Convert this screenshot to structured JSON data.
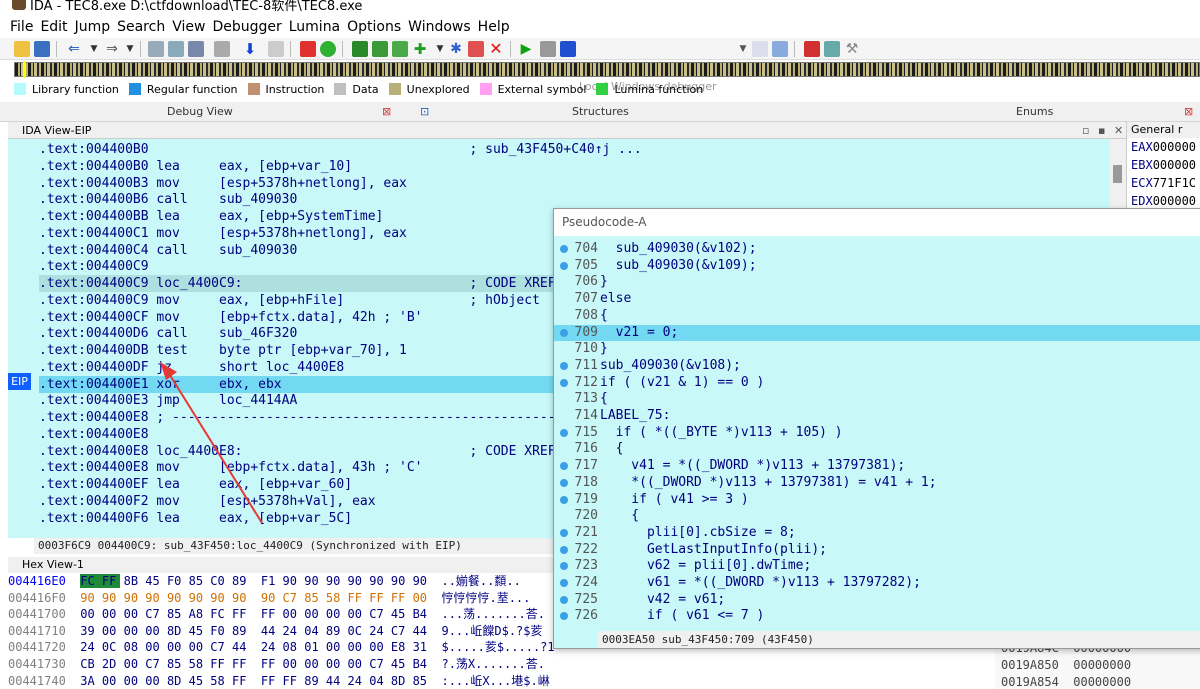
{
  "title": "IDA - TEC8.exe D:\\ctfdownload\\TEC-8软件\\TEC8.exe",
  "menu": [
    "File",
    "Edit",
    "Jump",
    "Search",
    "View",
    "Debugger",
    "Lumina",
    "Options",
    "Windows",
    "Help"
  ],
  "debugger_select": "Local Windows debugger",
  "legend": [
    {
      "label": "Library function",
      "color": "#b4fcfc"
    },
    {
      "label": "Regular function",
      "color": "#2090e0"
    },
    {
      "label": "Instruction",
      "color": "#c09070"
    },
    {
      "label": "Data",
      "color": "#c0c0c0"
    },
    {
      "label": "Unexplored",
      "color": "#b8b078"
    },
    {
      "label": "External symbol",
      "color": "#ffa0f0"
    },
    {
      "label": "Lumina function",
      "color": "#30d040"
    }
  ],
  "tabs": {
    "debug_view": "Debug View",
    "structures": "Structures",
    "enums": "Enums"
  },
  "ida_view": {
    "header": "IDA View-EIP",
    "lines": [
      ".text:004400B0                                         ; sub_43F450+C40↑j ...",
      ".text:004400B0 lea     eax, [ebp+var_10]",
      ".text:004400B3 mov     [esp+5378h+netlong], eax",
      ".text:004400B6 call    sub_409030",
      ".text:004400BB lea     eax, [ebp+SystemTime]",
      ".text:004400C1 mov     [esp+5378h+netlong], eax",
      ".text:004400C4 call    sub_409030",
      ".text:004400C9",
      ".text:004400C9 loc_4400C9:                             ; CODE XREF",
      ".text:004400C9 mov     eax, [ebp+hFile]                ; hObject",
      ".text:004400CF mov     [ebp+fctx.data], 42h ; 'B'",
      ".text:004400D6 call    sub_46F320",
      ".text:004400DB test    byte ptr [ebp+var_70], 1",
      ".text:004400DF jz      short loc_4400E8",
      ".text:004400E1 xor     ebx, ebx",
      ".text:004400E3 jmp     loc_4414AA",
      ".text:004400E8 ; ---------------------------------------------------------",
      ".text:004400E8",
      ".text:004400E8 loc_4400E8:                             ; CODE XREF",
      ".text:004400E8 mov     [ebp+fctx.data], 43h ; 'C'",
      ".text:004400EF lea     eax, [ebp+var_60]",
      ".text:004400F2 mov     [esp+5378h+Val], eax",
      ".text:004400F6 lea     eax, [ebp+var_5C]"
    ],
    "eip_label": "EIP",
    "status": "0003F6C9 004400C9: sub_43F450:loc_4400C9 (Synchronized with EIP)"
  },
  "registers": {
    "header": "General r",
    "rows": [
      {
        "name": "EAX",
        "val": "000000"
      },
      {
        "name": "EBX",
        "val": "000000"
      },
      {
        "name": "ECX",
        "val": "771F1C"
      },
      {
        "name": "EDX",
        "val": "000000"
      }
    ]
  },
  "hex_view": {
    "header": "Hex View-1",
    "rows": [
      {
        "addr": "004416E0",
        "bytes": "FC FF 8B 45 F0 85 C0 89  F1 90 90 90 90 90 90 90",
        "ascii": "..媊餐..纇.."
      },
      {
        "addr": "004416F0",
        "bytes": "90 90 90 90 90 90 90 90  90 C7 85 58 FF FF FF 00",
        "ascii": "悙悙悙悙.荎..."
      },
      {
        "addr": "00441700",
        "bytes": "00 00 00 C7 85 A8 FC FF  FF 00 00 00 00 C7 45 B4",
        "ascii": "...荡.......荅."
      },
      {
        "addr": "00441710",
        "bytes": "39 00 00 00 8D 45 F0 89  44 24 04 89 0C 24 C7 44",
        "ascii": "9...岴饓D$.?$荄"
      },
      {
        "addr": "00441720",
        "bytes": "24 0C 08 00 00 00 C7 44  24 08 01 00 00 00 E8 31",
        "ascii": "$.....荄$.....?1"
      },
      {
        "addr": "00441730",
        "bytes": "CB 2D 00 C7 85 58 FF FF  FF 00 00 00 00 C7 45 B4",
        "ascii": "?.荡X.......荅."
      },
      {
        "addr": "00441740",
        "bytes": "3A 00 00 00 8D 45 58 FF  FF FF 89 44 24 04 8D 85",
        "ascii": ":...岴X...塂$.崊"
      }
    ]
  },
  "stack": {
    "rows": [
      {
        "addr": "0019A84C",
        "val": "00000000"
      },
      {
        "addr": "0019A850",
        "val": "00000000"
      },
      {
        "addr": "0019A854",
        "val": "00000000"
      }
    ]
  },
  "pseudocode": {
    "header": "Pseudocode-A",
    "lines": [
      {
        "n": "704",
        "dot": true,
        "code": "  sub_409030(&v102);"
      },
      {
        "n": "705",
        "dot": true,
        "code": "  sub_409030(&v109);"
      },
      {
        "n": "706",
        "dot": false,
        "code": "}"
      },
      {
        "n": "707",
        "dot": false,
        "code": "else"
      },
      {
        "n": "708",
        "dot": false,
        "code": "{"
      },
      {
        "n": "709",
        "dot": true,
        "code": "  v21 = 0;"
      },
      {
        "n": "710",
        "dot": false,
        "code": "}"
      },
      {
        "n": "711",
        "dot": true,
        "code": "sub_409030(&v108);"
      },
      {
        "n": "712",
        "dot": true,
        "code": "if ( (v21 & 1) == 0 )"
      },
      {
        "n": "713",
        "dot": false,
        "code": "{"
      },
      {
        "n": "714",
        "dot": false,
        "code": "LABEL_75:"
      },
      {
        "n": "715",
        "dot": true,
        "code": "  if ( *((_BYTE *)v113 + 105) )"
      },
      {
        "n": "716",
        "dot": false,
        "code": "  {"
      },
      {
        "n": "717",
        "dot": true,
        "code": "    v41 = *((_DWORD *)v113 + 13797381);"
      },
      {
        "n": "718",
        "dot": true,
        "code": "    *((_DWORD *)v113 + 13797381) = v41 + 1;"
      },
      {
        "n": "719",
        "dot": true,
        "code": "    if ( v41 >= 3 )"
      },
      {
        "n": "720",
        "dot": false,
        "code": "    {"
      },
      {
        "n": "721",
        "dot": true,
        "code": "      plii[0].cbSize = 8;"
      },
      {
        "n": "722",
        "dot": true,
        "code": "      GetLastInputInfo(plii);"
      },
      {
        "n": "723",
        "dot": true,
        "code": "      v62 = plii[0].dwTime;"
      },
      {
        "n": "724",
        "dot": true,
        "code": "      v61 = *((_DWORD *)v113 + 13797282);"
      },
      {
        "n": "725",
        "dot": true,
        "code": "      v42 = v61;"
      },
      {
        "n": "726",
        "dot": true,
        "code": "      if ( v61 <= 7 )"
      }
    ],
    "status": "0003EA50 sub_43F450:709 (43F450)"
  }
}
